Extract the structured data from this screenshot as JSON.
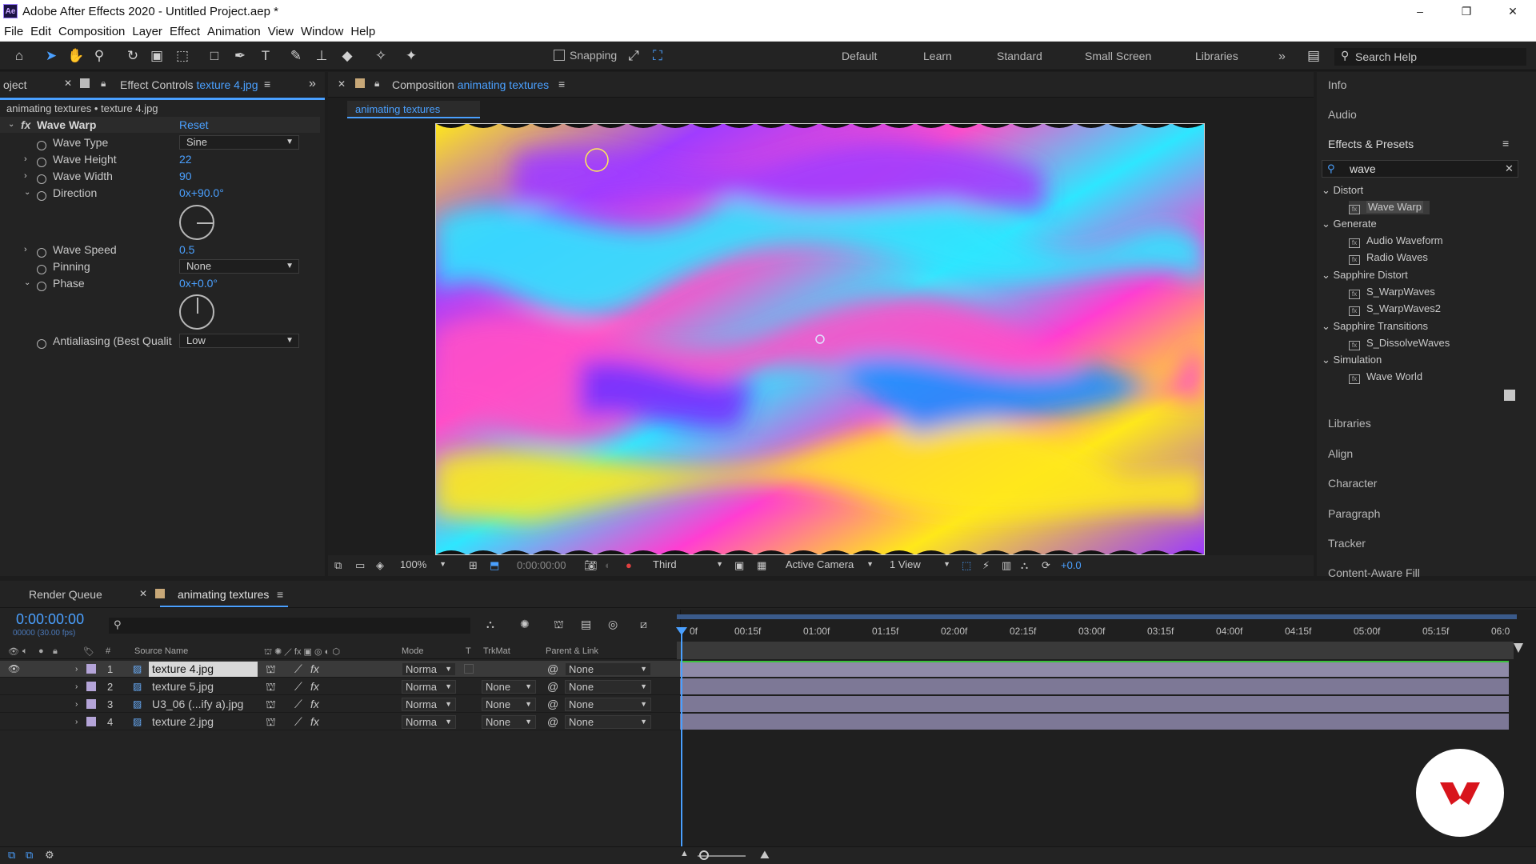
{
  "app": {
    "title": "Adobe After Effects 2020 - Untitled Project.aep *",
    "logo": "Ae",
    "window_controls": [
      "–",
      "❐",
      "✕"
    ]
  },
  "menu": [
    "File",
    "Edit",
    "Composition",
    "Layer",
    "Effect",
    "Animation",
    "View",
    "Window",
    "Help"
  ],
  "toolbar": {
    "snapping_label": "Snapping",
    "workspaces": [
      "Default",
      "Learn",
      "Standard",
      "Small Screen",
      "Libraries"
    ],
    "overflow": "»",
    "search_placeholder": "Search Help"
  },
  "effect_controls": {
    "project_tab": "oject",
    "tab_prefix": "Effect Controls",
    "tab_layer": "texture 4.jpg",
    "breadcrumb": "animating textures • texture 4.jpg",
    "effect_name": "Wave Warp",
    "reset_label": "Reset",
    "params": {
      "wave_type": {
        "label": "Wave Type",
        "value": "Sine"
      },
      "wave_height": {
        "label": "Wave Height",
        "value": "22"
      },
      "wave_width": {
        "label": "Wave Width",
        "value": "90"
      },
      "direction": {
        "label": "Direction",
        "value": "0x+90.0°"
      },
      "wave_speed": {
        "label": "Wave Speed",
        "value": "0.5"
      },
      "pinning": {
        "label": "Pinning",
        "value": "None"
      },
      "phase": {
        "label": "Phase",
        "value": "0x+0.0°"
      },
      "antialiasing": {
        "label": "Antialiasing (Best Qualit",
        "value": "Low"
      }
    }
  },
  "composition": {
    "tab_prefix": "Composition",
    "tab_name": "animating textures",
    "subtab": "animating textures",
    "zoom": "100%",
    "timecode": "0:00:00:00",
    "resolution": "Third",
    "camera": "Active Camera",
    "views": "1 View",
    "exposure": "+0.0"
  },
  "right_panel": {
    "top_items": [
      "Info",
      "Audio"
    ],
    "effects_presets_title": "Effects & Presets",
    "search_value": "wave",
    "groups": [
      {
        "name": "Distort",
        "items": [
          "Wave Warp"
        ]
      },
      {
        "name": "Generate",
        "items": [
          "Audio Waveform",
          "Radio Waves"
        ]
      },
      {
        "name": "Sapphire Distort",
        "items": [
          "S_WarpWaves",
          "S_WarpWaves2"
        ]
      },
      {
        "name": "Sapphire Transitions",
        "items": [
          "S_DissolveWaves"
        ]
      },
      {
        "name": "Simulation",
        "items": [
          "Wave World"
        ]
      }
    ],
    "bottom_items": [
      "Libraries",
      "Align",
      "Character",
      "Paragraph",
      "Tracker",
      "Content-Aware Fill"
    ]
  },
  "timeline": {
    "render_queue_tab": "Render Queue",
    "comp_tab": "animating textures",
    "timecode": "0:00:00:00",
    "fps": "00000 (30.00 fps)",
    "columns": {
      "hash": "#",
      "source": "Source Name",
      "mode": "Mode",
      "t": "T",
      "trkmat": "TrkMat",
      "parent": "Parent & Link"
    },
    "layers": [
      {
        "num": "1",
        "name": "texture 4.jpg",
        "mode": "Norma",
        "trkmat": "",
        "parent": "None"
      },
      {
        "num": "2",
        "name": "texture 5.jpg",
        "mode": "Norma",
        "trkmat": "None",
        "parent": "None"
      },
      {
        "num": "3",
        "name": "U3_06 (...ify a).jpg",
        "mode": "Norma",
        "trkmat": "None",
        "parent": "None"
      },
      {
        "num": "4",
        "name": "texture 2.jpg",
        "mode": "Norma",
        "trkmat": "None",
        "parent": "None"
      }
    ],
    "ruler": [
      "0f",
      "00:15f",
      "01:00f",
      "01:15f",
      "02:00f",
      "02:15f",
      "03:00f",
      "03:15f",
      "04:00f",
      "04:15f",
      "05:00f",
      "05:15f",
      "06:0"
    ]
  },
  "colors": {
    "accent": "#4aa0ff",
    "panel_bg": "#232323",
    "layer_bar": "#8f8aa8",
    "label_swatch": "#b4a4d8",
    "watermark_red": "#d8141c"
  }
}
